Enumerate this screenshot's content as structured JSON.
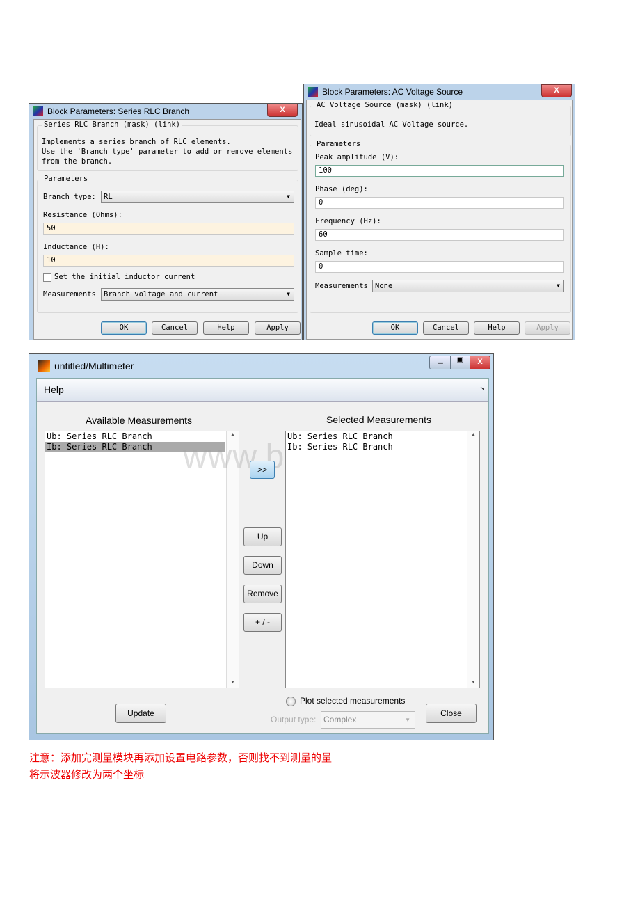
{
  "rlc_dialog": {
    "title": "Block Parameters: Series RLC Branch",
    "close": "X",
    "mask_title": "Series RLC Branch (mask) (link)",
    "description": [
      "Implements a series branch of RLC elements.",
      "Use the 'Branch type' parameter to add or remove elements",
      "from the branch."
    ],
    "parameters_label": "Parameters",
    "branch_type_label": "Branch type:",
    "branch_type_value": "RL",
    "resistance_label": "Resistance (Ohms):",
    "resistance_value": "50",
    "inductance_label": "Inductance (H):",
    "inductance_value": "10",
    "initial_current_label": "Set the initial inductor current",
    "initial_current_checked": false,
    "measurements_label": "Measurements",
    "measurements_value": "Branch voltage and current",
    "buttons": {
      "ok": "OK",
      "cancel": "Cancel",
      "help": "Help",
      "apply": "Apply"
    }
  },
  "ac_dialog": {
    "title": "Block Parameters: AC Voltage Source",
    "close": "X",
    "mask_title": "AC Voltage Source (mask) (link)",
    "description": "Ideal sinusoidal AC Voltage source.",
    "parameters_label": "Parameters",
    "peak_label": "Peak amplitude (V):",
    "peak_value": "100",
    "phase_label": "Phase (deg):",
    "phase_value": "0",
    "freq_label": "Frequency (Hz):",
    "freq_value": "60",
    "sample_label": "Sample time:",
    "sample_value": "0",
    "measurements_label": "Measurements",
    "measurements_value": "None",
    "buttons": {
      "ok": "OK",
      "cancel": "Cancel",
      "help": "Help",
      "apply": "Apply"
    }
  },
  "multimeter": {
    "title": "untitled/Multimeter",
    "menu_help": "Help",
    "available_label": "Available Measurements",
    "selected_label": "Selected Measurements",
    "available_items": [
      "Ub: Series RLC Branch",
      "Ib: Series RLC Branch"
    ],
    "available_selected_index": 1,
    "selected_items": [
      "Ub: Series RLC Branch",
      "Ib: Series RLC Branch"
    ],
    "add_button": ">>",
    "up": "Up",
    "down": "Down",
    "remove": "Remove",
    "plusminus": "+ / -",
    "update": "Update",
    "plot_label": "Plot selected measurements",
    "output_type_label": "Output type:",
    "output_type_value": "Complex",
    "close": "Close",
    "watermark": "www.bdocx.com"
  },
  "notes": [
    "注意：添加完测量模块再添加设置电路参数，否则找不到测量的量",
    "将示波器修改为两个坐标"
  ],
  "colors": {
    "note_red": "#ee0000",
    "yellow_field": "#fdf3e0"
  }
}
